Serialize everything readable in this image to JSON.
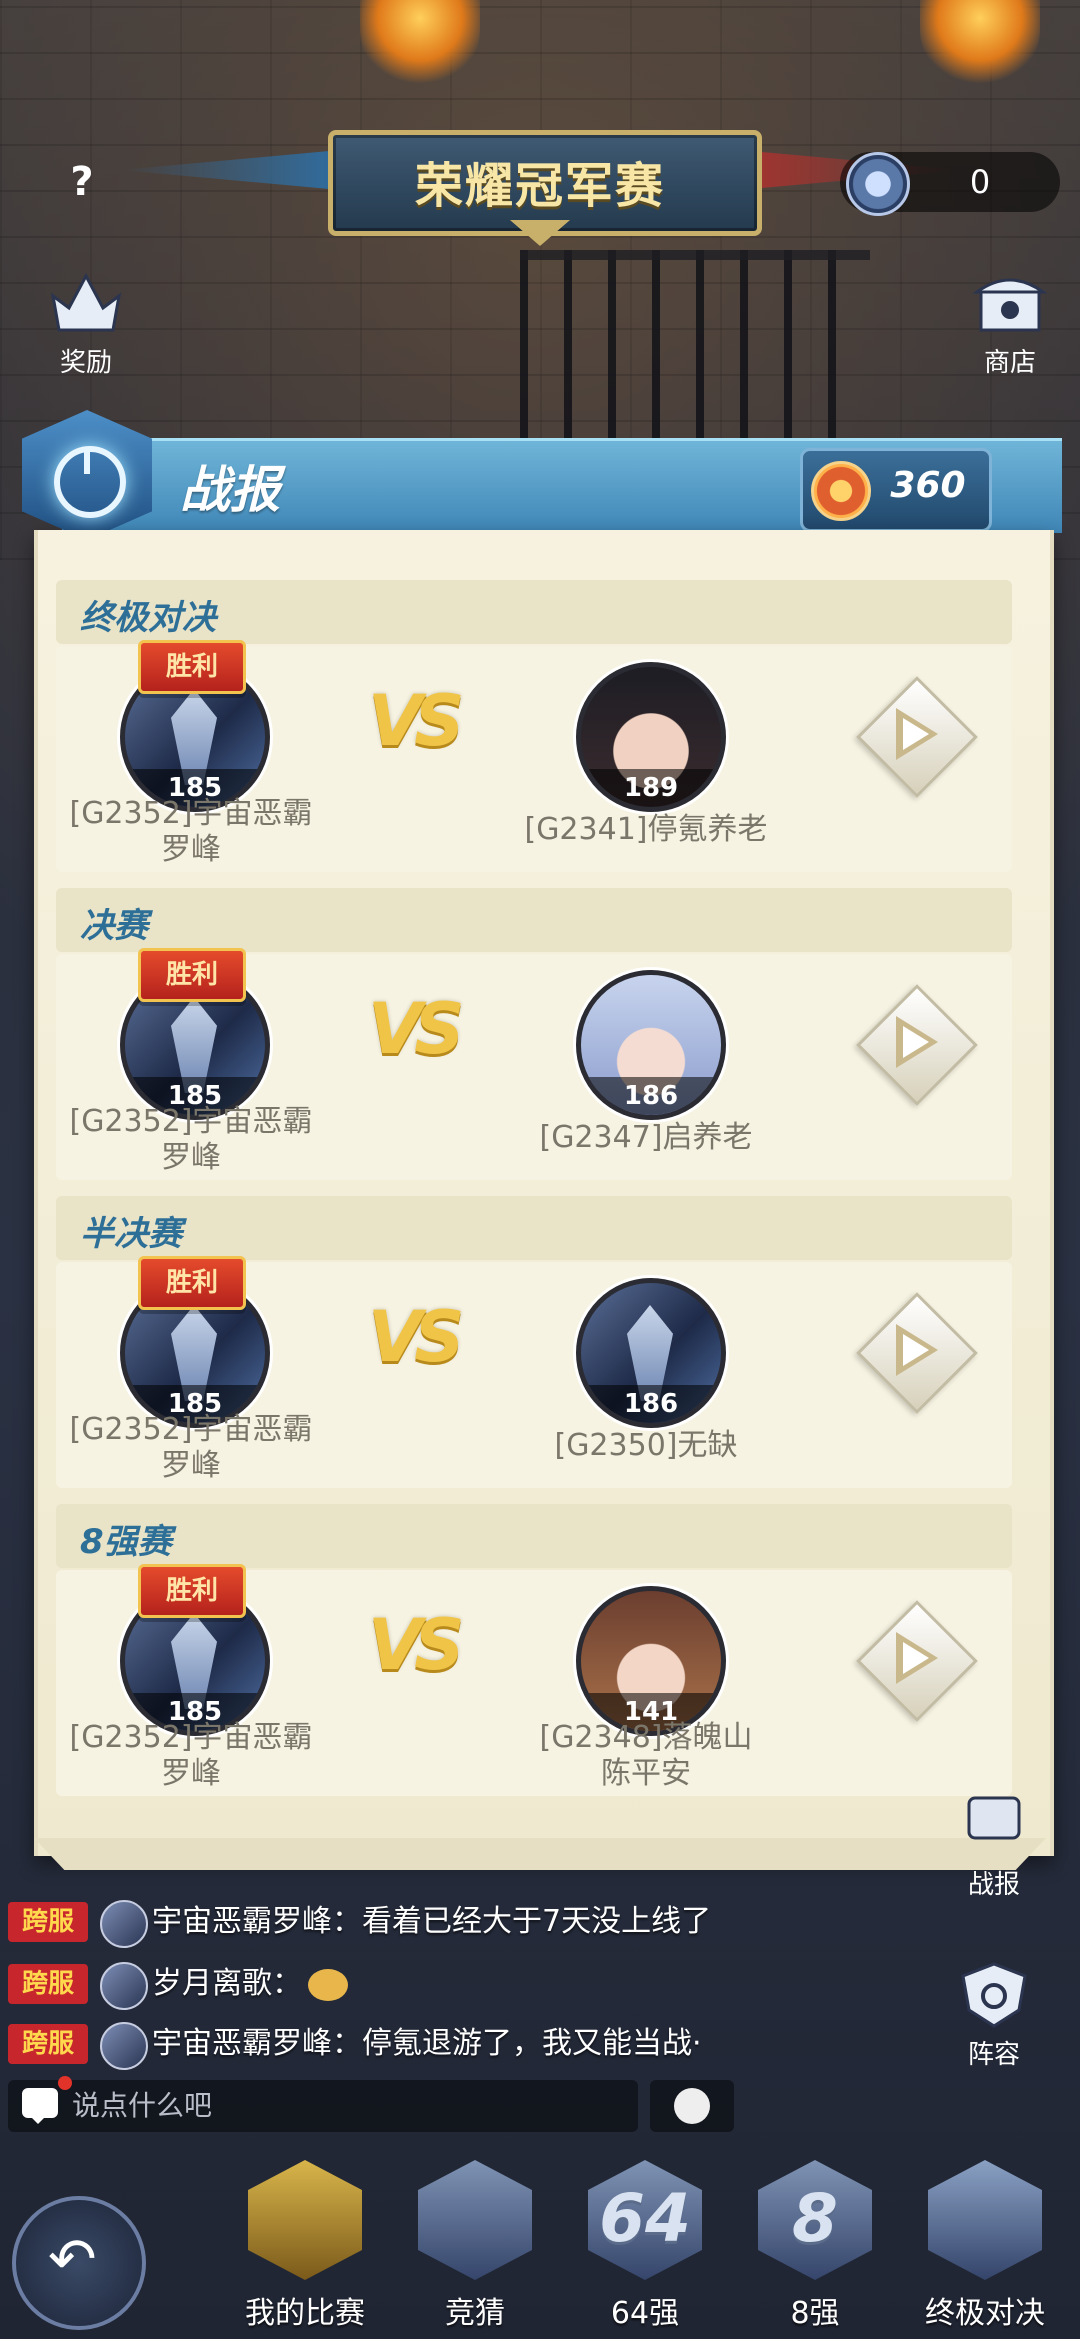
{
  "header": {
    "title": "荣耀冠军赛",
    "help_symbol": "?",
    "currency_value": "0",
    "left_button": "奖励",
    "right_button": "商店"
  },
  "panel": {
    "title": "战报",
    "score": "360"
  },
  "win_label": "胜利",
  "vs_label": "VS",
  "matches": [
    {
      "stage": "终极对决",
      "left_level": "185",
      "left_name": "[G2352]宇宙恶霸罗峰",
      "right_level": "189",
      "right_name": "[G2341]停氪养老"
    },
    {
      "stage": "决赛",
      "left_level": "185",
      "left_name": "[G2352]宇宙恶霸罗峰",
      "right_level": "186",
      "right_name": "[G2347]启养老"
    },
    {
      "stage": "半决赛",
      "left_level": "185",
      "left_name": "[G2352]宇宙恶霸罗峰",
      "right_level": "186",
      "right_name": "[G2350]无缺"
    },
    {
      "stage": "8强赛",
      "left_level": "185",
      "left_name": "[G2352]宇宙恶霸罗峰",
      "right_level": "141",
      "right_name": "[G2348]落魄山陈平安"
    }
  ],
  "side": {
    "battle_report": "战报",
    "lineup": "阵容"
  },
  "chat": {
    "tag": "跨服",
    "messages": [
      {
        "text": "宇宙恶霸罗峰：看着已经大于7天没上线了"
      },
      {
        "text": "岁月离歌："
      },
      {
        "text": "宇宙恶霸罗峰：停氪退游了，我又能当战·"
      }
    ],
    "placeholder": "说点什么吧"
  },
  "nav": {
    "items": [
      {
        "label": "我的比赛",
        "big": ""
      },
      {
        "label": "竞猜",
        "big": ""
      },
      {
        "label": "64强",
        "big": "64"
      },
      {
        "label": "8强",
        "big": "8"
      },
      {
        "label": "终极对决",
        "big": ""
      }
    ]
  },
  "colors": {
    "stage_title": "#2e6f98",
    "win_badge": "#c8262d",
    "chat_tag": "#c8262d"
  }
}
